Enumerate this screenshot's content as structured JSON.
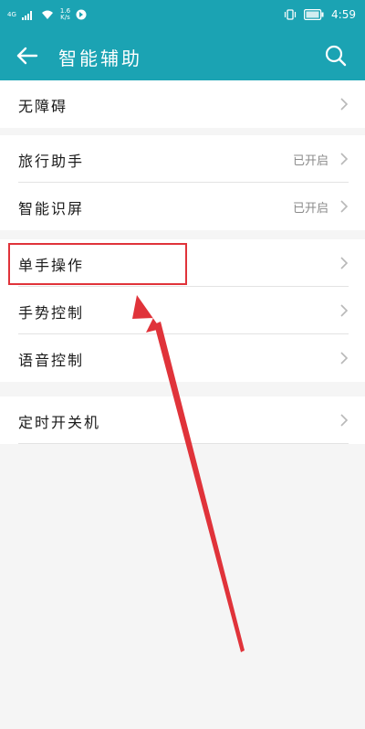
{
  "status_bar": {
    "signal": "4G",
    "net_speed_value": "1.6",
    "net_speed_unit": "K/s",
    "time": "4:59"
  },
  "header": {
    "title": "智能辅助"
  },
  "groups": [
    {
      "items": [
        {
          "label": "无障碍",
          "value": ""
        }
      ]
    },
    {
      "items": [
        {
          "label": "旅行助手",
          "value": "已开启"
        },
        {
          "label": "智能识屏",
          "value": "已开启"
        }
      ]
    },
    {
      "items": [
        {
          "label": "单手操作",
          "value": ""
        },
        {
          "label": "手势控制",
          "value": ""
        },
        {
          "label": "语音控制",
          "value": ""
        }
      ]
    },
    {
      "items": [
        {
          "label": "定时开关机",
          "value": ""
        }
      ]
    }
  ],
  "colors": {
    "header_bg": "#1ba3b3",
    "annotation": "#e0333a"
  }
}
